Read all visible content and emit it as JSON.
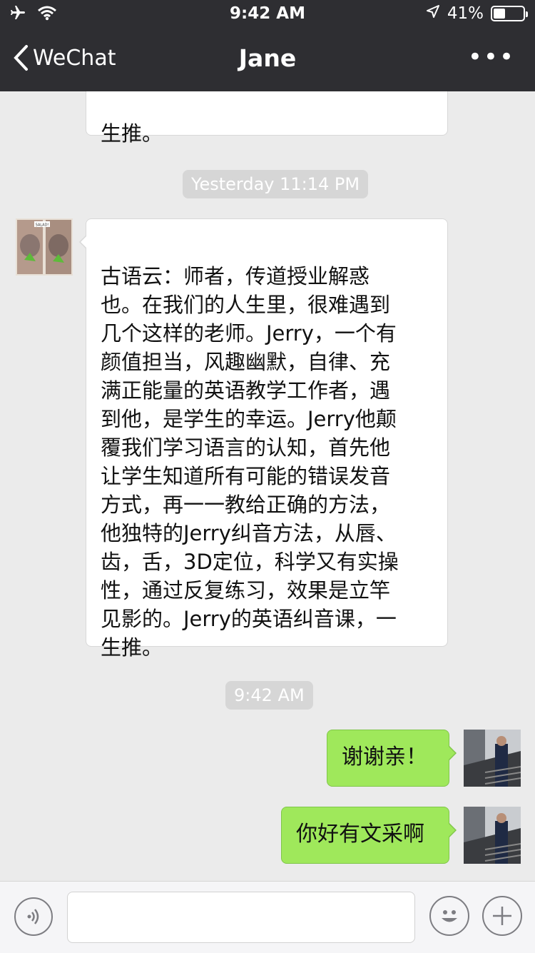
{
  "status_bar": {
    "time": "9:42 AM",
    "battery": "41%",
    "battery_level": 0.41
  },
  "nav": {
    "back_label": "WeChat",
    "title": "Jane",
    "more_label": "•••"
  },
  "messages": {
    "prev_fragment": "生推。",
    "stamp_yesterday": "Yesterday 11:14 PM",
    "long_message_lines": [
      "古语云：师者，传道授业解惑",
      "也。在我们的人生里，很难遇到",
      "几个这样的老师。Jerry，一个有",
      "颜值担当，风趣幽默，自律、充",
      "满正能量的英语教学工作者，遇",
      "到他，是学生的幸运。Jerry他颠",
      "覆我们学习语言的认知，首先他",
      "让学生知道所有可能的错误发音",
      "方式，再一一教给正确的方法，",
      "他独特的Jerry纠音方法，从唇、",
      "齿，舌，3D定位，科学又有实操",
      "性，通过反复练习，效果是立竿",
      "见影的。Jerry的英语纠音课，一",
      "生推。"
    ],
    "stamp_now": "9:42 AM",
    "reply_1": "谢谢亲！",
    "reply_2": "你好有文采啊",
    "avatar_caption": "SALAD!"
  },
  "icons": {
    "airplane": "airplane-icon",
    "wifi": "wifi-icon",
    "location": "location-arrow-icon",
    "voice": "voice-icon",
    "emoji": "emoji-icon",
    "plus": "plus-icon"
  },
  "colors": {
    "nav_bg": "#2e2e32",
    "chat_bg": "#ebebeb",
    "out_bubble": "#9fe85b",
    "stamp_bg": "#d6d6d6"
  }
}
